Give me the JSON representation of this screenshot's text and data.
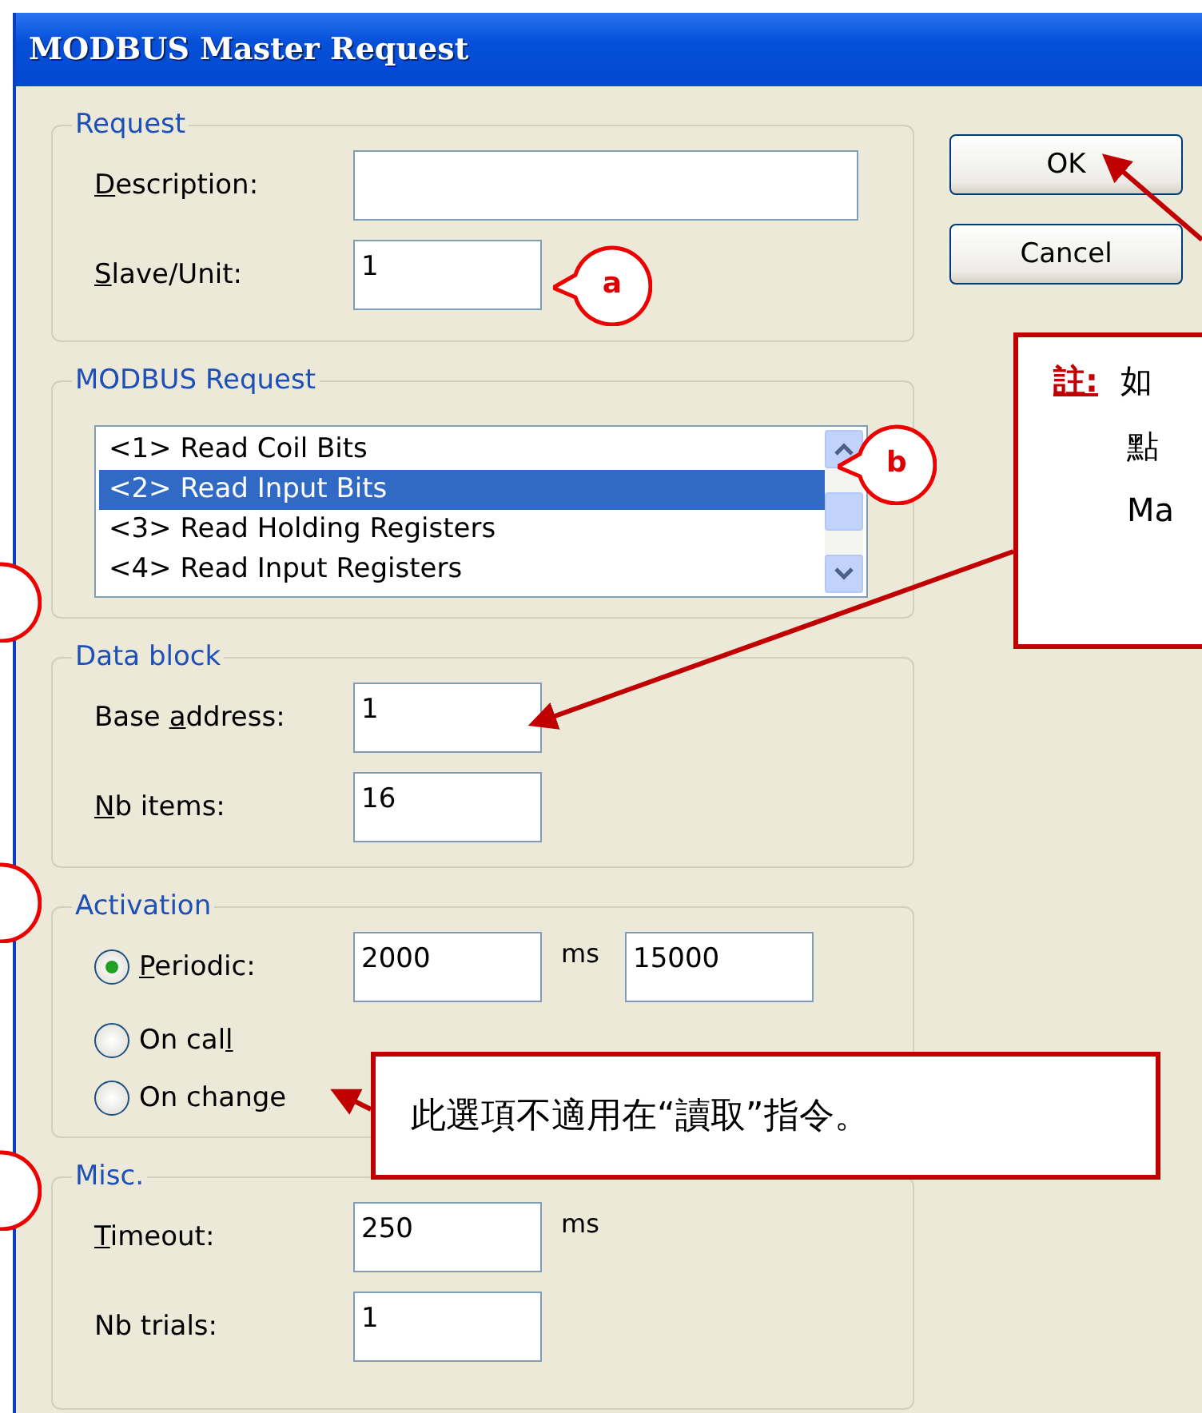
{
  "window": {
    "title": "MODBUS Master Request"
  },
  "buttons": [
    {
      "label": "OK"
    },
    {
      "label": "Cancel"
    }
  ],
  "request": {
    "title": "Request",
    "fields": [
      {
        "key": "D",
        "label_post": "escription:"
      },
      {
        "key": "S",
        "label_post": "lave/Unit:",
        "value": "1"
      }
    ]
  },
  "modbus_request": {
    "title": "MODBUS Request",
    "items": [
      {
        "label": "<1> Read Coil Bits",
        "selected": false
      },
      {
        "label": "<2> Read Input Bits",
        "selected": true
      },
      {
        "label": "<3> Read Holding Registers",
        "selected": false
      },
      {
        "label": "<4> Read Input Registers",
        "selected": false
      }
    ]
  },
  "data_block": {
    "title": "Data block",
    "fields": [
      {
        "label_pre": "Base ",
        "key": "a",
        "label_post": "ddress:",
        "value": "1"
      },
      {
        "key": "N",
        "label_post": "b items:",
        "value": "16"
      }
    ]
  },
  "activation": {
    "title": "Activation",
    "options": [
      {
        "key": "P",
        "label_post": "eriodic:",
        "selected": true
      },
      {
        "label_pre": "On cal",
        "key": "l",
        "selected": false
      },
      {
        "label_pre": "On chan",
        "key": "g",
        "label_post": "e",
        "selected": false
      }
    ],
    "period": "2000",
    "period_unit": "ms",
    "error_period": "15000"
  },
  "misc": {
    "title": "Misc.",
    "fields": [
      {
        "key": "T",
        "label_post": "imeout:",
        "value": "250",
        "unit": "ms"
      },
      {
        "label_pre": "Nb trials:",
        "value": "1"
      }
    ]
  },
  "callouts": [
    {
      "kind": "letter",
      "text": "a"
    },
    {
      "kind": "letter",
      "text": "b"
    },
    {
      "kind": "cut"
    },
    {
      "kind": "cut"
    },
    {
      "kind": "cut"
    }
  ],
  "note": {
    "heading": "註:",
    "lines": [
      "如",
      "點",
      "Ma"
    ]
  },
  "hint": {
    "text": "此選項不適用在“讀取”指令。"
  }
}
